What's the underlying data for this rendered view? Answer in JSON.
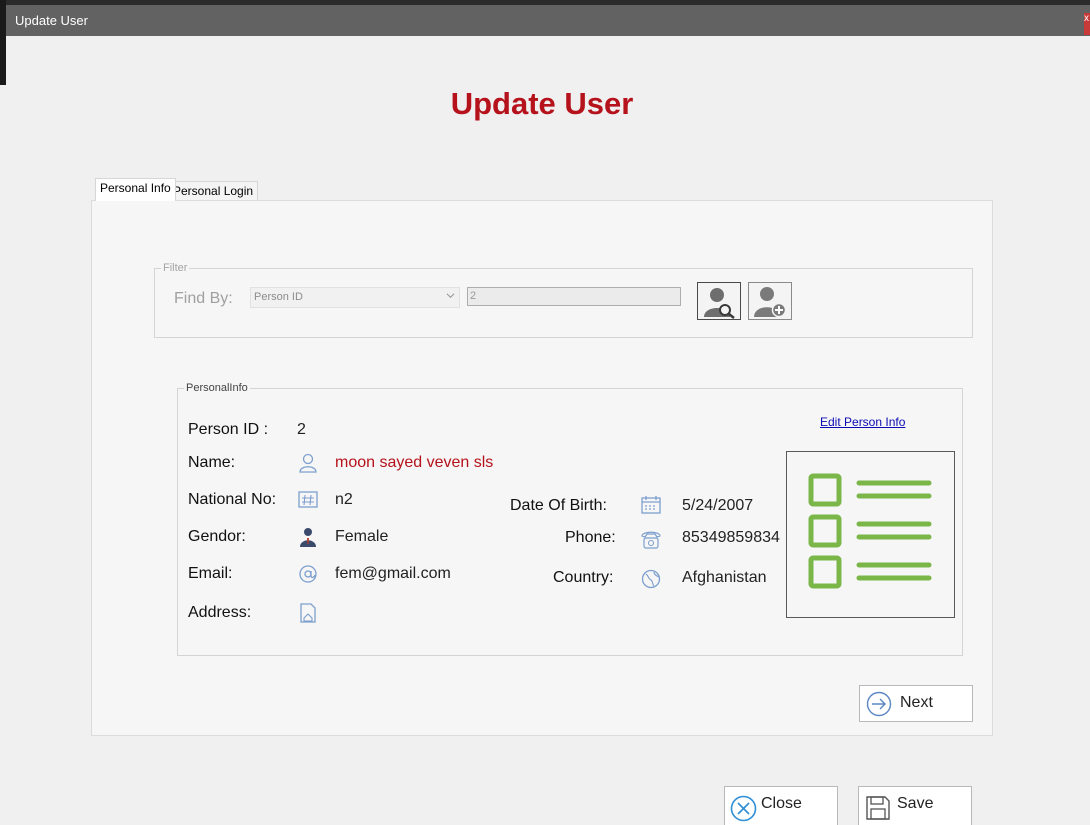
{
  "window": {
    "title": "Update User",
    "close_glyph": "x"
  },
  "heading": "Update User",
  "tabs": [
    {
      "label": "Personal Info",
      "active": true
    },
    {
      "label": "Personal Login",
      "active": false
    }
  ],
  "filter": {
    "legend": "Filter",
    "find_by_label": "Find By:",
    "select_value": "Person ID",
    "input_value": "2",
    "find_button_icon": "person-search-icon",
    "add_button_icon": "person-add-icon"
  },
  "person_info": {
    "legend": "PersonalInfo",
    "edit_link": "Edit Person Info",
    "person_id_label": "Person ID :",
    "person_id": "2",
    "name_label": "Name:",
    "name": "moon sayed veven sls",
    "national_no_label": "National No:",
    "national_no": "n2",
    "gender_label": "Gendor:",
    "gender": "Female",
    "email_label": "Email:",
    "email": "fem@gmail.com",
    "address_label": "Address:",
    "address": "",
    "dob_label": "Date Of Birth:",
    "dob": "5/24/2007",
    "phone_label": "Phone:",
    "phone": "85349859834",
    "country_label": "Country:",
    "country": "Afghanistan",
    "photo_icon": "checklist-icon"
  },
  "buttons": {
    "next": "Next",
    "close": "Close",
    "save": "Save"
  },
  "colors": {
    "heading": "#b5121b",
    "titlebar": "#626262",
    "accent_green": "#7ab648",
    "icon_blue": "#6a8fc4"
  }
}
